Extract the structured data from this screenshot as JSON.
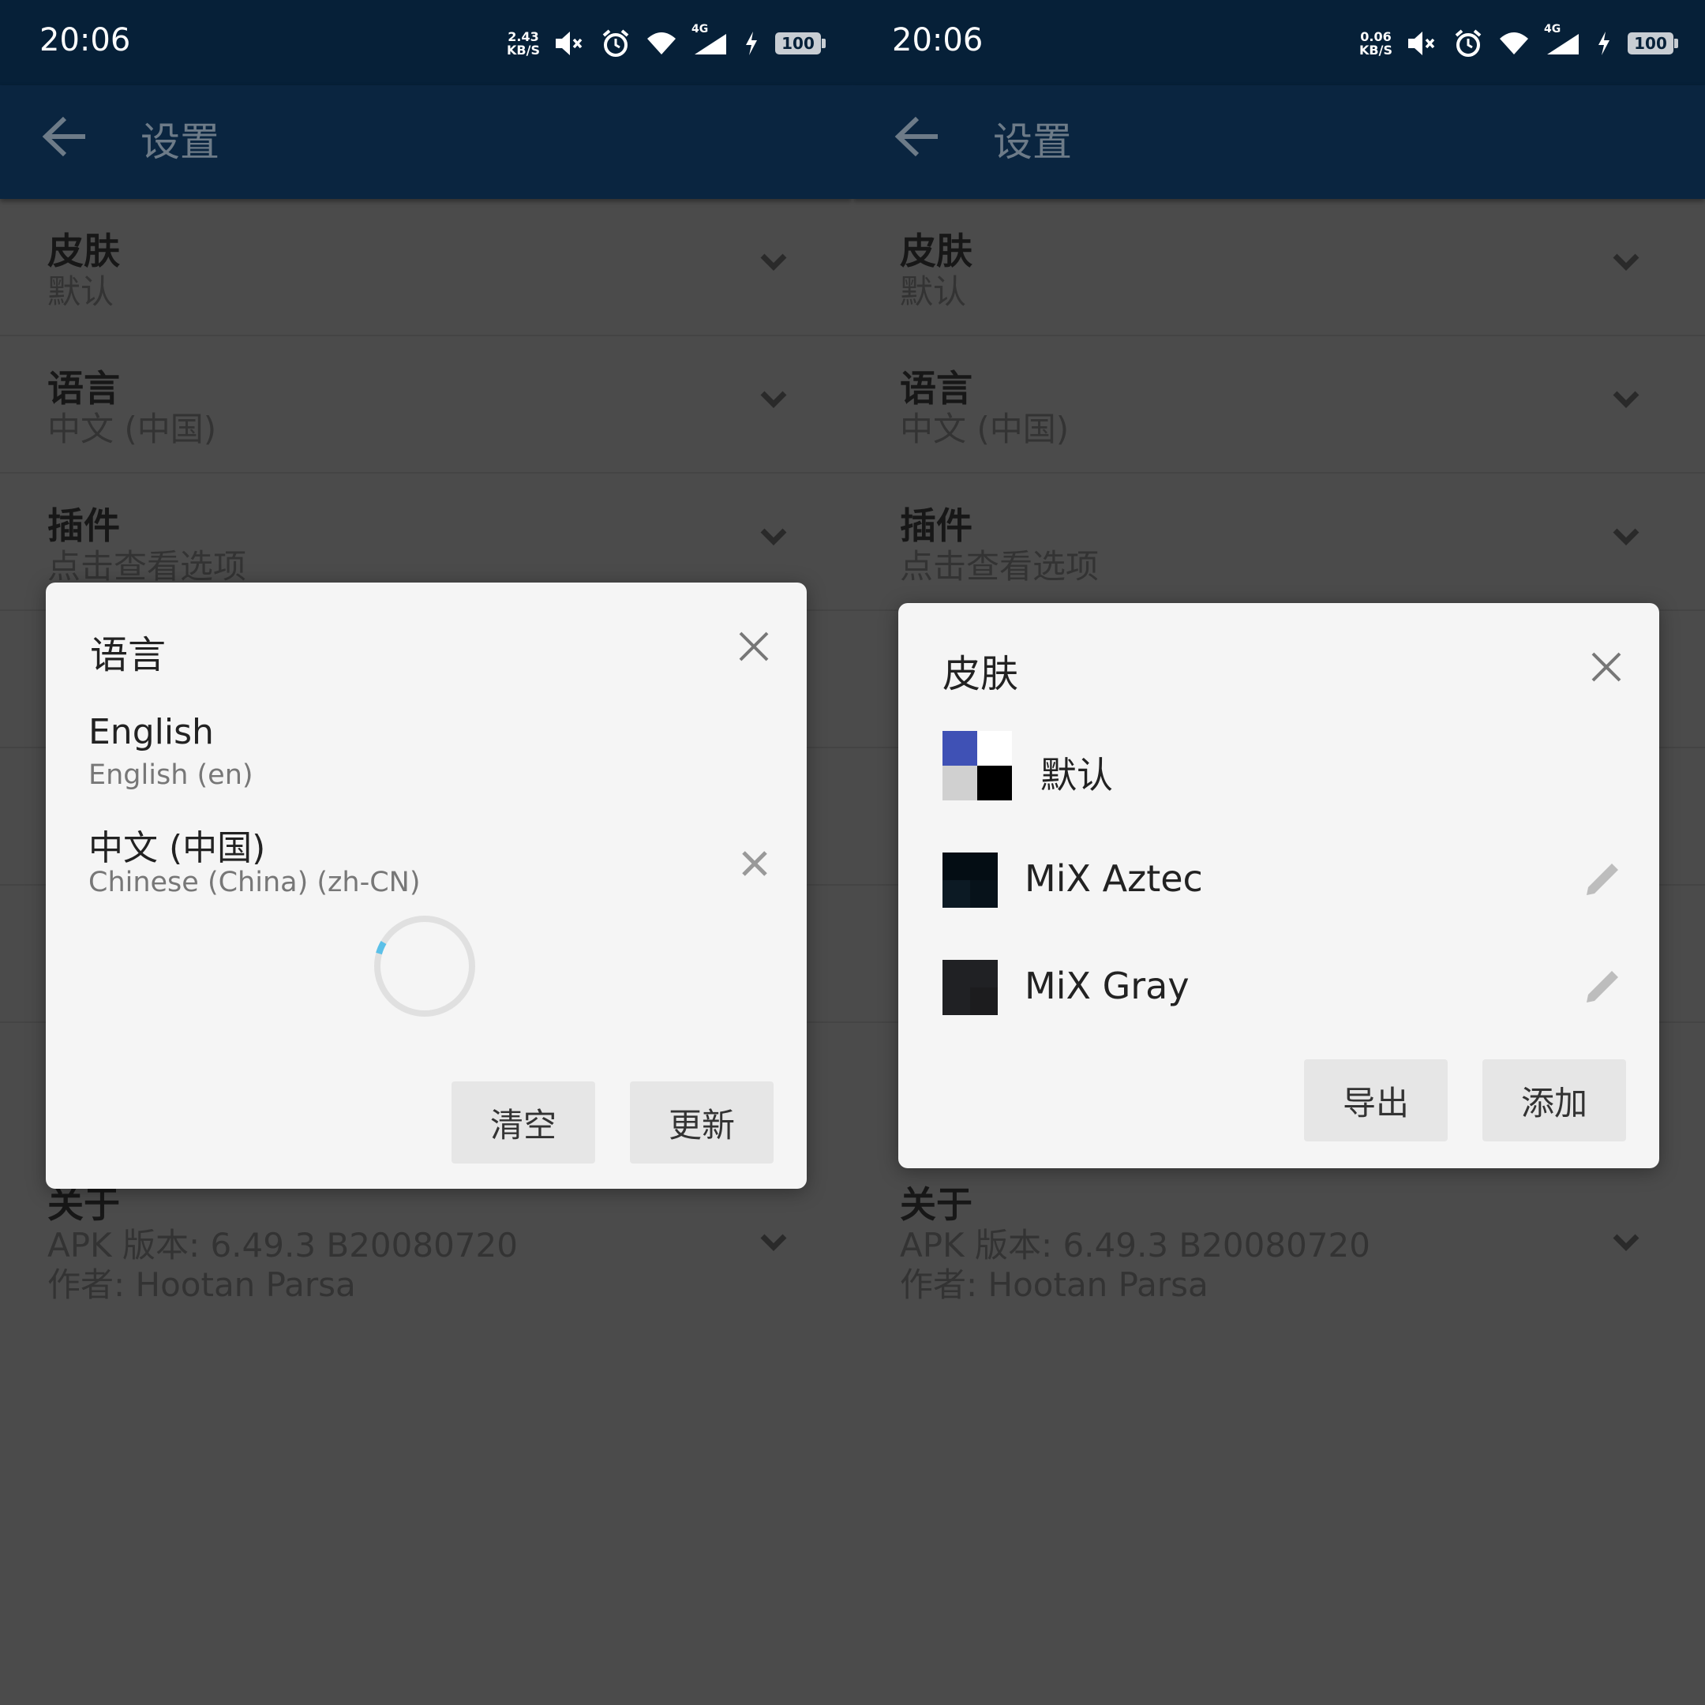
{
  "left": {
    "status": {
      "time": "20:06",
      "net_speed": "2.43",
      "net_unit": "KB/S",
      "network": "4G",
      "battery": "100"
    },
    "appbar": {
      "title": "设置"
    },
    "settings": [
      {
        "title": "皮肤",
        "value": "默认"
      },
      {
        "title": "语言",
        "value": "中文 (中国)"
      },
      {
        "title": "插件",
        "value": "点击查看选项"
      }
    ],
    "about": {
      "title": "关于",
      "version": "APK 版本: 6.49.3  B20080720",
      "author": "作者: Hootan Parsa"
    },
    "dialog": {
      "title": "语言",
      "languages": [
        {
          "name": "English",
          "code": "English (en)"
        },
        {
          "name": "中文 (中国)",
          "code": "Chinese (China) (zh-CN)"
        }
      ],
      "buttons": {
        "clear": "清空",
        "update": "更新"
      }
    }
  },
  "right": {
    "status": {
      "time": "20:06",
      "net_speed": "0.06",
      "net_unit": "KB/S",
      "network": "4G",
      "battery": "100"
    },
    "appbar": {
      "title": "设置"
    },
    "settings": [
      {
        "title": "皮肤",
        "value": "默认"
      },
      {
        "title": "语言",
        "value": "中文 (中国)"
      },
      {
        "title": "插件",
        "value": "点击查看选项"
      }
    ],
    "about": {
      "title": "关于",
      "version": "APK 版本: 6.49.3  B20080720",
      "author": "作者: Hootan Parsa"
    },
    "dialog": {
      "title": "皮肤",
      "skins": [
        {
          "name": "默认"
        },
        {
          "name": "MiX Aztec"
        },
        {
          "name": "MiX Gray"
        }
      ],
      "buttons": {
        "export": "导出",
        "add": "添加"
      }
    }
  },
  "colors": {
    "statusbar": "#062038",
    "appbar": "#0a2540",
    "background": "#4b4b4b",
    "dialog": "#f5f5f5",
    "spinner_accent": "#5bc0e8"
  }
}
